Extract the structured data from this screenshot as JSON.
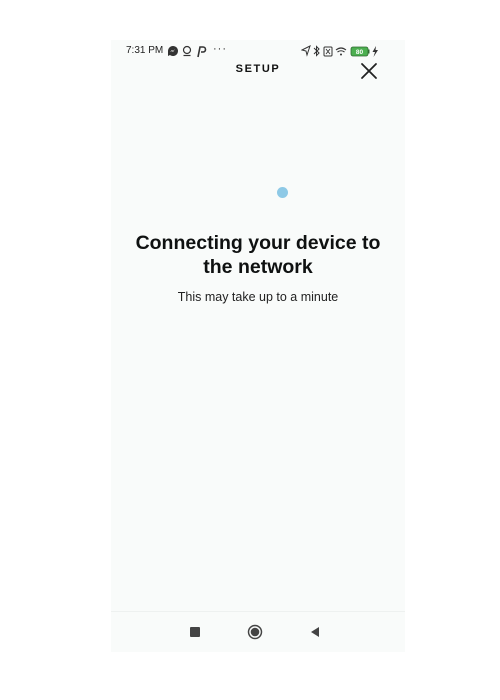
{
  "status_bar": {
    "time": "7:31 PM",
    "dots": "···",
    "battery": "80",
    "icons_left": [
      "messenger-icon",
      "alexa-icon",
      "pinterest-icon"
    ],
    "icons_right": [
      "location-icon",
      "bluetooth-icon",
      "sim-icon",
      "wifi-icon",
      "battery-icon",
      "charging-icon"
    ]
  },
  "header": {
    "title": "SETUP",
    "close_icon": "close-icon"
  },
  "main": {
    "title": "Connecting your device to the network",
    "subtitle": "This may take up to a minute",
    "spinner_color": "#8ec9e6"
  },
  "nav_bar": {
    "icons": [
      "recents-icon",
      "home-icon",
      "back-icon"
    ]
  },
  "colors": {
    "background": "#f9fbfa",
    "text": "#0f1111",
    "accent": "#8ec9e6",
    "battery_green": "#4caf50"
  }
}
